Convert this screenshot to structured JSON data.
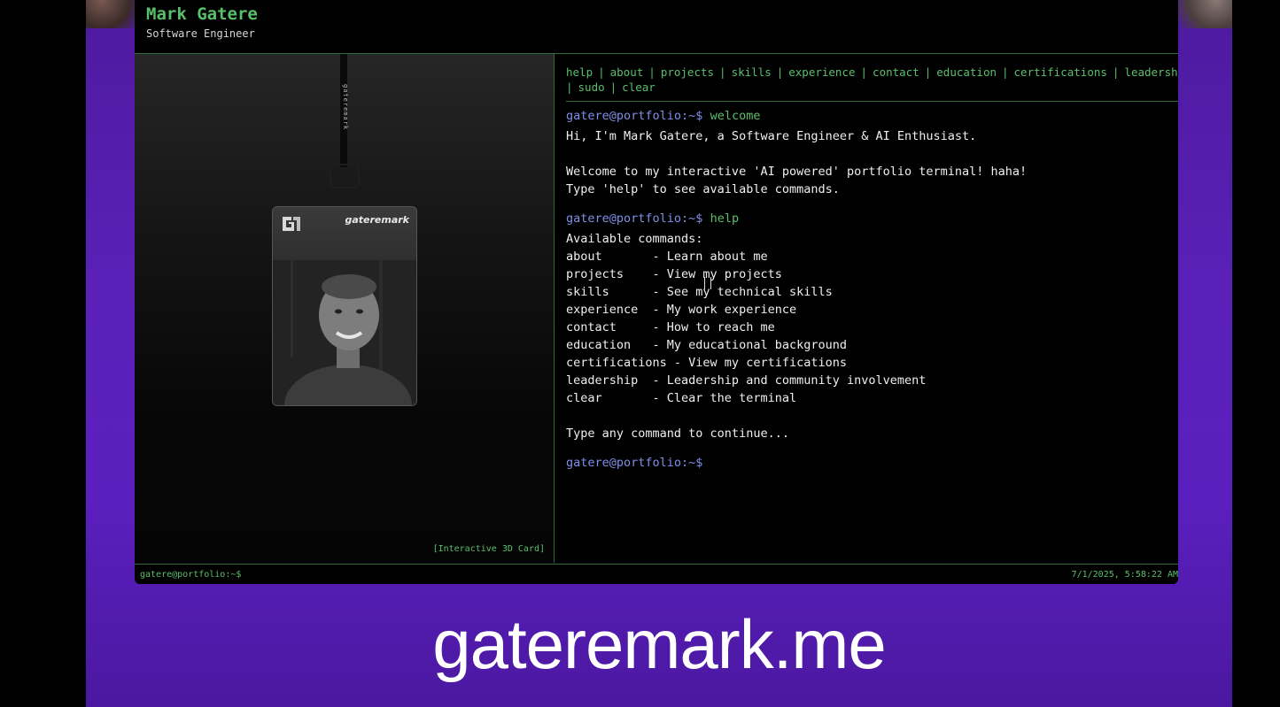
{
  "header": {
    "name": "Mark Gatere",
    "role": "Software Engineer"
  },
  "card": {
    "brand": "gateremark",
    "lanyard_text": "gateremark",
    "caption": "[Interactive 3D Card]"
  },
  "menu": {
    "items": [
      {
        "label": "help"
      },
      {
        "label": "about"
      },
      {
        "label": "projects"
      },
      {
        "label": "skills"
      },
      {
        "label": "experience"
      },
      {
        "label": "contact"
      },
      {
        "label": "education"
      },
      {
        "label": "certifications"
      },
      {
        "label": "leadership"
      },
      {
        "label": "sudo"
      },
      {
        "label": "clear"
      }
    ],
    "separator": "|"
  },
  "terminal": {
    "prompt": "gatere@portfolio:~$",
    "cmd1": "welcome",
    "welcome_lines": [
      "Hi, I'm Mark Gatere, a Software Engineer & AI Enthusiast.",
      "",
      "Welcome to my interactive 'AI powered' portfolio terminal! haha!",
      "Type 'help' to see available commands."
    ],
    "cmd2": "help",
    "help_title": "Available commands:",
    "help_rows": [
      "about       - Learn about me",
      "projects    - View my projects",
      "skills      - See my technical skills",
      "experience  - My work experience",
      "contact     - How to reach me",
      "education   - My educational background",
      "certifications - View my certifications",
      "leadership  - Leadership and community involvement",
      "clear       - Clear the terminal"
    ],
    "help_footer": "Type any command to continue..."
  },
  "status": {
    "left": "gatere@portfolio:~$",
    "right": "7/1/2025, 5:58:22 AM"
  },
  "overlay": {
    "domain": "gateremark.me"
  },
  "colors": {
    "accent_green": "#5cbf6c",
    "prompt_blue": "#7e8fe6",
    "purple": "#5a20b8"
  }
}
